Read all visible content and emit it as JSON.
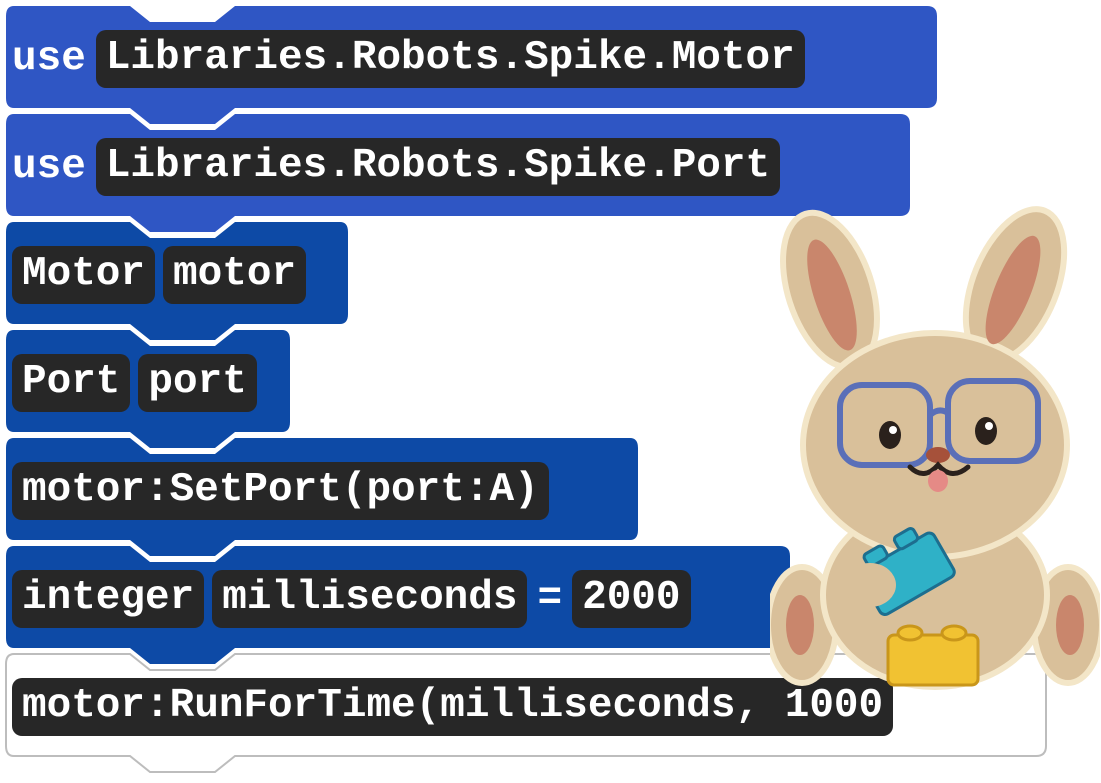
{
  "colors": {
    "block_light": "#2f56c4",
    "block_dark": "#0d4aa6",
    "pill": "#272727",
    "selected_block_border": "#bdbdbd"
  },
  "blocks": [
    {
      "keyword": "use",
      "value": "Libraries.Robots.Spike.Motor"
    },
    {
      "keyword": "use",
      "value": "Libraries.Robots.Spike.Port"
    },
    {
      "type": "Motor",
      "name": "motor"
    },
    {
      "type": "Port",
      "name": "port"
    },
    {
      "call": "motor:SetPort(port:A)"
    },
    {
      "type": "integer",
      "name": "milliseconds",
      "operator": "=",
      "value": "2000"
    },
    {
      "call": "motor:RunForTime(milliseconds, 1000"
    }
  ],
  "mascot": {
    "icon": "bunny-with-glasses-holding-bricks"
  }
}
